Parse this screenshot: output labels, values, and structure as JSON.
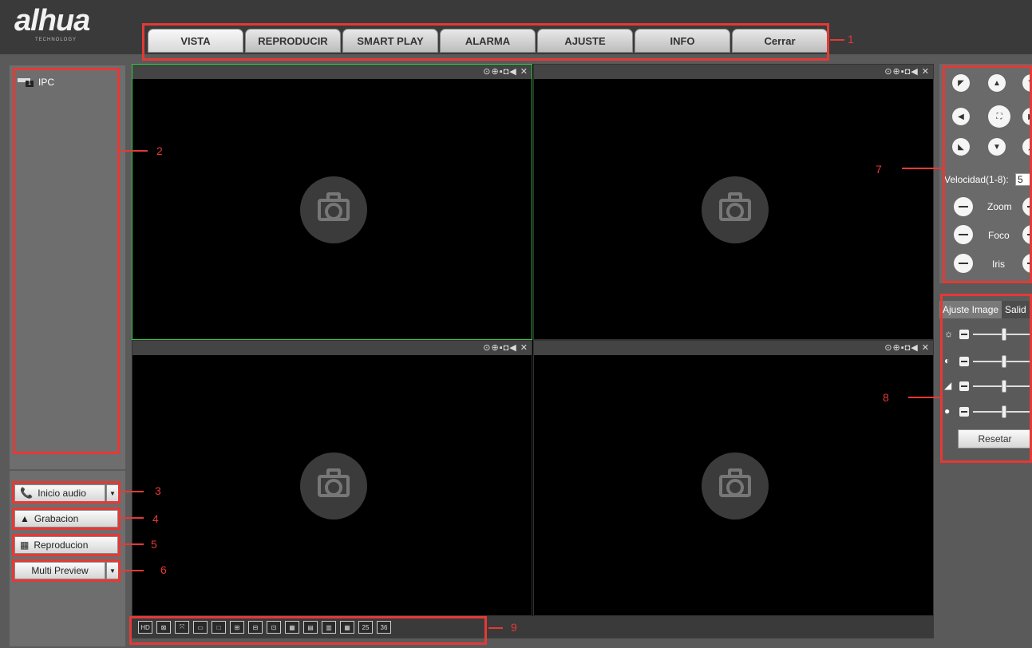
{
  "logo": {
    "text": "alhua",
    "sub": "TECHNOLOGY"
  },
  "nav": {
    "tabs": [
      {
        "label": "VISTA",
        "active": true
      },
      {
        "label": "REPRODUCIR",
        "active": false
      },
      {
        "label": "SMART PLAY",
        "active": false
      },
      {
        "label": "ALARMA",
        "active": false
      },
      {
        "label": "AJUSTE",
        "active": false
      },
      {
        "label": "INFO",
        "active": false
      },
      {
        "label": "Cerrar",
        "active": false
      }
    ]
  },
  "device_tree": {
    "items": [
      {
        "label": "IPC",
        "icon": "camera-device-icon"
      }
    ]
  },
  "side_buttons": {
    "audio": {
      "label": "Inicio audio",
      "icon": "phone-icon"
    },
    "record": {
      "label": "Grabacion",
      "icon": "warning-icon"
    },
    "playback": {
      "label": "Reproducion",
      "icon": "film-icon"
    },
    "multi_preview": {
      "label": "Multi Preview"
    }
  },
  "video_panes": {
    "toolbar_glyphs": "⊙⊕▪◘◀ ✕",
    "count": 4
  },
  "ptz": {
    "speed_label": "Velocidad(1-8):",
    "speed_value": "5",
    "zoom_label": "Zoom",
    "focus_label": "Foco",
    "iris_label": "Iris"
  },
  "image_adjust": {
    "tab_active": "Ajuste Image",
    "tab_inactive": "Salid",
    "sliders": [
      {
        "icon": "brightness-icon",
        "level": 0.5
      },
      {
        "icon": "contrast-icon",
        "level": 0.5
      },
      {
        "icon": "saturation-icon",
        "level": 0.5
      },
      {
        "icon": "hue-icon",
        "level": 0.5
      }
    ],
    "reset_label": "Resetar"
  },
  "layout_bar": {
    "buttons": [
      "HD",
      "⊠",
      "⤧",
      "▭",
      "□",
      "⊞",
      "⊟",
      "⊡",
      "▦",
      "▤",
      "▥",
      "▦",
      "25",
      "36"
    ]
  },
  "annotations": [
    "1",
    "2",
    "3",
    "4",
    "5",
    "6",
    "7",
    "8",
    "9"
  ],
  "colors": {
    "annotation": "#e53935",
    "active_pane": "#2ecc40"
  }
}
